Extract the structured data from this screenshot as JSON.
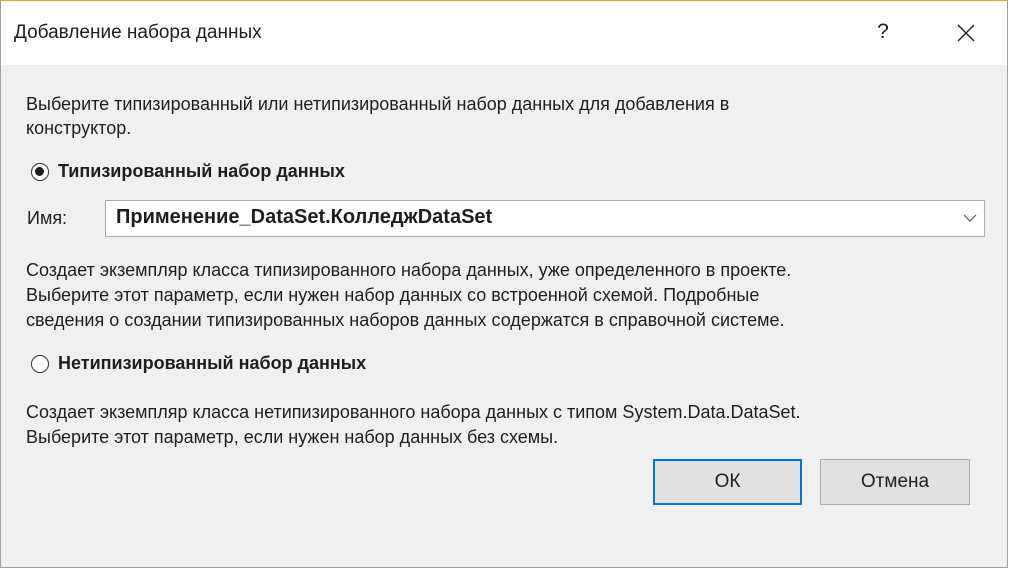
{
  "dialog": {
    "title": "Добавление набора данных",
    "help_label": "?",
    "intro": [
      "Выберите типизированный или нетипизированный набор данных для добавления в",
      "конструктор."
    ],
    "typed_option": {
      "label": "Типизированный набор данных",
      "checked": true,
      "name_label": "Имя:",
      "name_value": "Применение_DataSet.КолледжDataSet",
      "description": [
        "Создает экземпляр класса типизированного набора данных, уже определенного в проекте.",
        "Выберите этот параметр, если нужен набор данных со встроенной схемой. Подробные",
        "сведения о создании типизированных наборов данных содержатся в справочной системе."
      ]
    },
    "untyped_option": {
      "label": "Нетипизированный набор данных",
      "checked": false,
      "description": [
        "Создает экземпляр класса нетипизированного набора данных с типом System.Data.DataSet.",
        "Выберите этот параметр, если нужен набор данных без схемы."
      ]
    },
    "buttons": {
      "ok": "ОК",
      "cancel": "Отмена"
    },
    "icons": {
      "close": "close-icon",
      "dropdown": "chevron-down-icon"
    },
    "colors": {
      "accent": "#0078d7",
      "title_border": "#e8a23a",
      "background": "#f0f0f0"
    }
  }
}
